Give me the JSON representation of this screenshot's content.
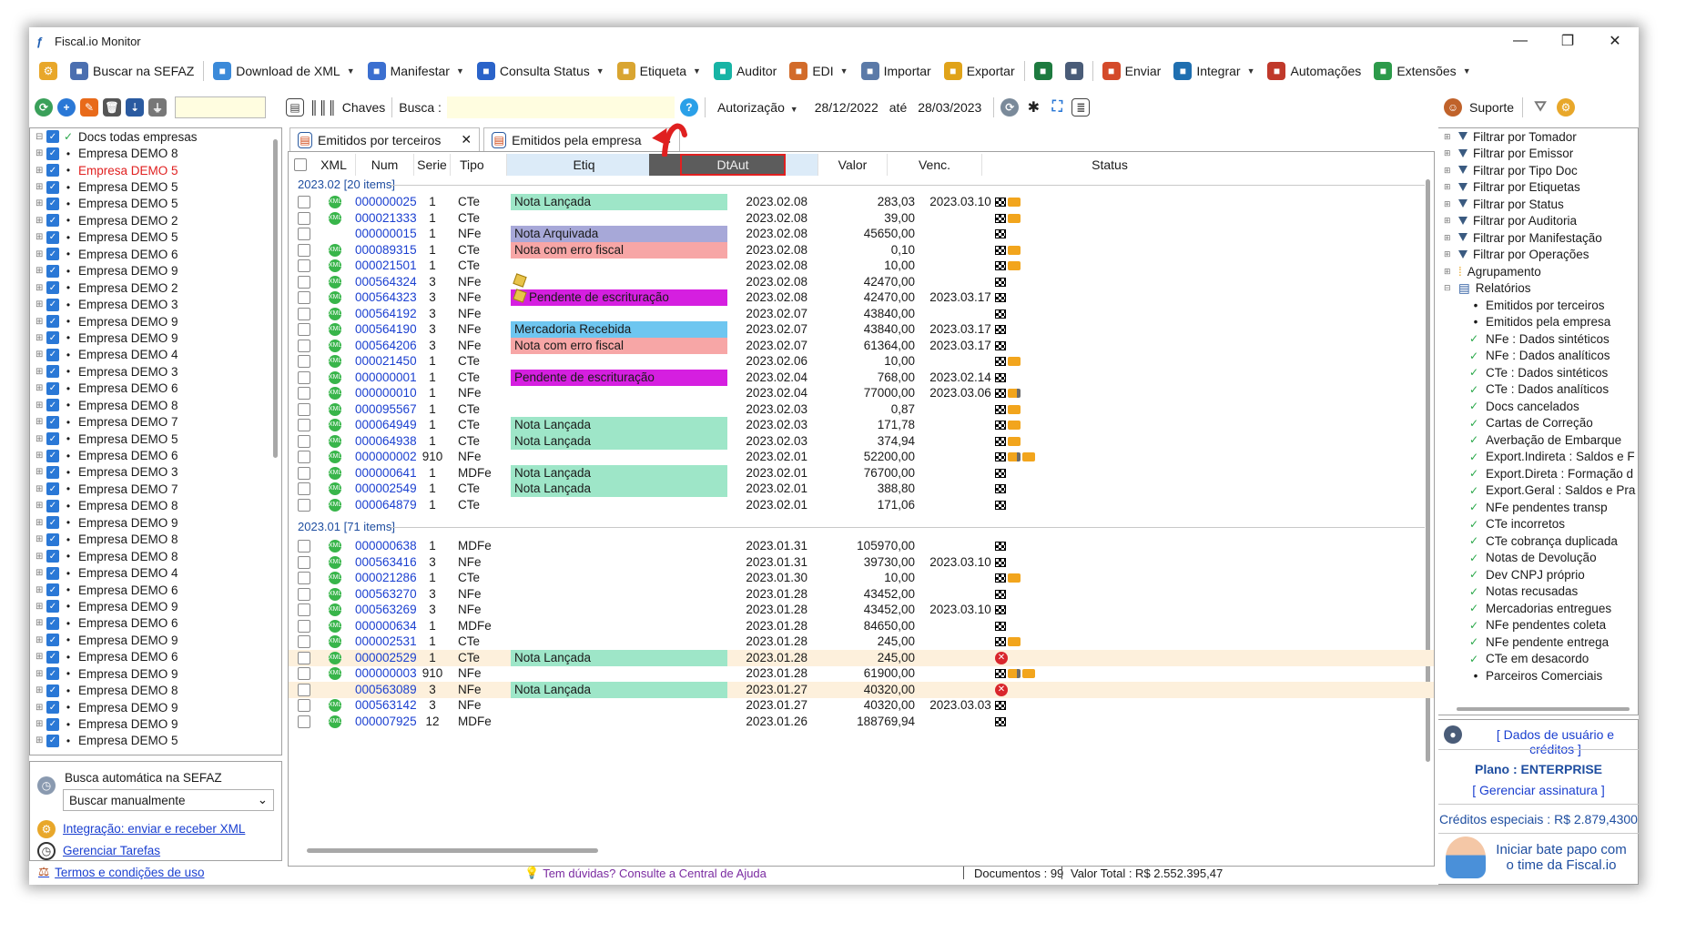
{
  "window": {
    "title": "Fiscal.io Monitor",
    "minimize": "—",
    "restore": "❐",
    "close": "✕"
  },
  "toolbar": {
    "items": [
      {
        "label": "Buscar na SEFAZ",
        "icon": "cloud-search-icon",
        "caret": false,
        "color": "#4b6fb0"
      },
      {
        "label": "Download de XML",
        "icon": "xml-download-icon",
        "caret": true,
        "color": "#3b8ad9"
      },
      {
        "label": "Manifestar",
        "icon": "manifest-icon",
        "caret": true,
        "color": "#3b6fd0"
      },
      {
        "label": "Consulta Status",
        "icon": "status-check-icon",
        "caret": true,
        "color": "#2a63c9"
      },
      {
        "label": "Etiqueta",
        "icon": "tag-icon",
        "caret": true,
        "color": "#d9a531"
      },
      {
        "label": "Auditor",
        "icon": "auditor-icon",
        "caret": false,
        "color": "#17b4a5"
      },
      {
        "label": "EDI",
        "icon": "truck-icon",
        "caret": true,
        "color": "#d26b2a"
      },
      {
        "label": "Importar",
        "icon": "import-icon",
        "caret": false,
        "color": "#5b7aa8"
      },
      {
        "label": "Exportar",
        "icon": "export-icon",
        "caret": false,
        "color": "#e0a31a"
      },
      {
        "label": "",
        "icon": "excel-icon",
        "caret": false,
        "color": "#1d7a3f"
      },
      {
        "label": "",
        "icon": "print-icon",
        "caret": false,
        "color": "#4a5c78"
      },
      {
        "label": "Enviar",
        "icon": "mail-icon",
        "caret": false,
        "color": "#d44a2a"
      },
      {
        "label": "Integrar",
        "icon": "integrate-icon",
        "caret": true,
        "color": "#1f6fb0"
      },
      {
        "label": "Automações",
        "icon": "automation-icon",
        "caret": false,
        "color": "#c0392b"
      },
      {
        "label": "Extensões",
        "icon": "extensions-icon",
        "caret": true,
        "color": "#2c9a4a"
      }
    ]
  },
  "left": {
    "tree_root": "Docs todas empresas",
    "companies": [
      {
        "label": "Empresa DEMO 8",
        "red": false
      },
      {
        "label": "Empresa DEMO 5",
        "red": true
      },
      {
        "label": "Empresa DEMO 5",
        "red": false
      },
      {
        "label": "Empresa DEMO 5",
        "red": false
      },
      {
        "label": "Empresa DEMO 2",
        "red": false
      },
      {
        "label": "Empresa DEMO 5",
        "red": false
      },
      {
        "label": "Empresa DEMO 6",
        "red": false
      },
      {
        "label": "Empresa DEMO 9",
        "red": false
      },
      {
        "label": "Empresa DEMO 2",
        "red": false
      },
      {
        "label": "Empresa DEMO 3",
        "red": false
      },
      {
        "label": "Empresa DEMO 9",
        "red": false
      },
      {
        "label": "Empresa DEMO 9",
        "red": false
      },
      {
        "label": "Empresa DEMO 4",
        "red": false
      },
      {
        "label": "Empresa DEMO 3",
        "red": false
      },
      {
        "label": "Empresa DEMO 6",
        "red": false
      },
      {
        "label": "Empresa DEMO 8",
        "red": false
      },
      {
        "label": "Empresa DEMO 7",
        "red": false
      },
      {
        "label": "Empresa DEMO 5",
        "red": false
      },
      {
        "label": "Empresa DEMO 6",
        "red": false
      },
      {
        "label": "Empresa DEMO 3",
        "red": false
      },
      {
        "label": "Empresa DEMO 7",
        "red": false
      },
      {
        "label": "Empresa DEMO 8",
        "red": false
      },
      {
        "label": "Empresa DEMO 9",
        "red": false
      },
      {
        "label": "Empresa DEMO 8",
        "red": false
      },
      {
        "label": "Empresa DEMO 8",
        "red": false
      },
      {
        "label": "Empresa DEMO 4",
        "red": false
      },
      {
        "label": "Empresa DEMO 6",
        "red": false
      },
      {
        "label": "Empresa DEMO 9",
        "red": false
      },
      {
        "label": "Empresa DEMO 6",
        "red": false
      },
      {
        "label": "Empresa DEMO 9",
        "red": false
      },
      {
        "label": "Empresa DEMO 6",
        "red": false
      },
      {
        "label": "Empresa DEMO 9",
        "red": false
      },
      {
        "label": "Empresa DEMO 8",
        "red": false
      },
      {
        "label": "Empresa DEMO 9",
        "red": false
      },
      {
        "label": "Empresa DEMO 9",
        "red": false
      },
      {
        "label": "Empresa DEMO 5",
        "red": false
      }
    ],
    "auto_title": "Busca automática na SEFAZ",
    "auto_select": "Buscar manualmente",
    "integration_link": "Integração: enviar e receber XML",
    "tasks_link": "Gerenciar Tarefas",
    "terms_link": "Termos e condições de uso"
  },
  "main": {
    "chaves_label": "Chaves",
    "busca_label": "Busca :",
    "date_field_label": "Autorização",
    "date_from": "28/12/2022",
    "ate_label": "até",
    "date_to": "28/03/2023",
    "tabs": [
      {
        "label": "Emitidos por terceiros",
        "close": "✕"
      },
      {
        "label": "Emitidos pela empresa",
        "close": "✕"
      }
    ],
    "headers": {
      "xml": "XML",
      "num": "Num",
      "serie": "Serie",
      "tipo": "Tipo",
      "etiq": "Etiq",
      "dtaut": "DtAut",
      "valor": "Valor",
      "venc": "Venc.",
      "status": "Status"
    },
    "group1": "2023.02 [20 items]",
    "group2": "2023.01 [71 items]",
    "rows_group1": [
      {
        "num": "000000025",
        "serie": "1",
        "tipo": "CTe",
        "etiq": "Nota Lançada",
        "etiq_color": "#9ee6c8",
        "etiq_icon": false,
        "xml": true,
        "dt": "2023.02.08",
        "valor": "283,03",
        "venc": "2023.03.10",
        "status": [
          "flag",
          "truck"
        ]
      },
      {
        "num": "000021333",
        "serie": "1",
        "tipo": "CTe",
        "etiq": "",
        "etiq_color": "",
        "etiq_icon": false,
        "xml": true,
        "dt": "2023.02.08",
        "valor": "39,00",
        "venc": "",
        "status": [
          "flag",
          "truck"
        ]
      },
      {
        "num": "000000015",
        "serie": "1",
        "tipo": "NFe",
        "etiq": "Nota Arquivada",
        "etiq_color": "#a7a8d8",
        "etiq_icon": false,
        "xml": false,
        "dt": "2023.02.08",
        "valor": "45650,00",
        "venc": "",
        "status": [
          "flag"
        ]
      },
      {
        "num": "000089315",
        "serie": "1",
        "tipo": "CTe",
        "etiq": "Nota com erro fiscal",
        "etiq_color": "#f7a6a6",
        "etiq_icon": false,
        "xml": true,
        "dt": "2023.02.08",
        "valor": "0,10",
        "venc": "",
        "status": [
          "flag",
          "truck"
        ]
      },
      {
        "num": "000021501",
        "serie": "1",
        "tipo": "CTe",
        "etiq": "",
        "etiq_color": "",
        "etiq_icon": false,
        "xml": true,
        "dt": "2023.02.08",
        "valor": "10,00",
        "venc": "",
        "status": [
          "flag",
          "truck"
        ]
      },
      {
        "num": "000564324",
        "serie": "3",
        "tipo": "NFe",
        "etiq": "",
        "etiq_color": "",
        "etiq_icon": true,
        "xml": true,
        "dt": "2023.02.08",
        "valor": "42470,00",
        "venc": "",
        "status": [
          "flag"
        ]
      },
      {
        "num": "000564323",
        "serie": "3",
        "tipo": "NFe",
        "etiq": "Pendente de escrituração",
        "etiq_color": "#d51fe0",
        "etiq_icon": true,
        "xml": true,
        "dt": "2023.02.08",
        "valor": "42470,00",
        "venc": "2023.03.17",
        "status": [
          "flag"
        ]
      },
      {
        "num": "000564192",
        "serie": "3",
        "tipo": "NFe",
        "etiq": "",
        "etiq_color": "",
        "etiq_icon": false,
        "xml": true,
        "dt": "2023.02.07",
        "valor": "43840,00",
        "venc": "",
        "status": [
          "flag"
        ]
      },
      {
        "num": "000564190",
        "serie": "3",
        "tipo": "NFe",
        "etiq": "Mercadoria Recebida",
        "etiq_color": "#6ec6f0",
        "etiq_icon": false,
        "xml": true,
        "dt": "2023.02.07",
        "valor": "43840,00",
        "venc": "2023.03.17",
        "status": [
          "flag"
        ]
      },
      {
        "num": "000564206",
        "serie": "3",
        "tipo": "NFe",
        "etiq": "Nota com erro fiscal",
        "etiq_color": "#f7a6a6",
        "etiq_icon": false,
        "xml": true,
        "dt": "2023.02.07",
        "valor": "61364,00",
        "venc": "2023.03.17",
        "status": [
          "flag"
        ]
      },
      {
        "num": "000021450",
        "serie": "1",
        "tipo": "CTe",
        "etiq": "",
        "etiq_color": "",
        "etiq_icon": false,
        "xml": true,
        "dt": "2023.02.06",
        "valor": "10,00",
        "venc": "",
        "status": [
          "flag",
          "truck"
        ]
      },
      {
        "num": "000000001",
        "serie": "1",
        "tipo": "CTe",
        "etiq": "Pendente de escrituração",
        "etiq_color": "#d51fe0",
        "etiq_icon": false,
        "xml": true,
        "dt": "2023.02.04",
        "valor": "768,00",
        "venc": "2023.02.14",
        "status": [
          "flag"
        ]
      },
      {
        "num": "000000010",
        "serie": "1",
        "tipo": "NFe",
        "etiq": "",
        "etiq_color": "",
        "etiq_icon": false,
        "xml": true,
        "dt": "2023.02.04",
        "valor": "77000,00",
        "venc": "2023.03.06",
        "status": [
          "flag",
          "truck2"
        ]
      },
      {
        "num": "000095567",
        "serie": "1",
        "tipo": "CTe",
        "etiq": "",
        "etiq_color": "",
        "etiq_icon": false,
        "xml": true,
        "dt": "2023.02.03",
        "valor": "0,87",
        "venc": "",
        "status": [
          "flag",
          "truck"
        ]
      },
      {
        "num": "000064949",
        "serie": "1",
        "tipo": "CTe",
        "etiq": "Nota Lançada",
        "etiq_color": "#9ee6c8",
        "etiq_icon": false,
        "xml": true,
        "dt": "2023.02.03",
        "valor": "171,78",
        "venc": "",
        "status": [
          "flag",
          "truck"
        ]
      },
      {
        "num": "000064938",
        "serie": "1",
        "tipo": "CTe",
        "etiq": "Nota Lançada",
        "etiq_color": "#9ee6c8",
        "etiq_icon": false,
        "xml": true,
        "dt": "2023.02.03",
        "valor": "374,94",
        "venc": "",
        "status": [
          "flag",
          "truck"
        ]
      },
      {
        "num": "000000002",
        "serie": "910",
        "tipo": "NFe",
        "etiq": "",
        "etiq_color": "",
        "etiq_icon": false,
        "xml": true,
        "dt": "2023.02.01",
        "valor": "52200,00",
        "venc": "",
        "status": [
          "flag",
          "truck2",
          "truck"
        ]
      },
      {
        "num": "000000641",
        "serie": "1",
        "tipo": "MDFe",
        "etiq": "Nota Lançada",
        "etiq_color": "#9ee6c8",
        "etiq_icon": false,
        "xml": true,
        "dt": "2023.02.01",
        "valor": "76700,00",
        "venc": "",
        "status": [
          "flag"
        ]
      },
      {
        "num": "000002549",
        "serie": "1",
        "tipo": "CTe",
        "etiq": "Nota Lançada",
        "etiq_color": "#9ee6c8",
        "etiq_icon": false,
        "xml": true,
        "dt": "2023.02.01",
        "valor": "388,80",
        "venc": "",
        "status": [
          "flag"
        ]
      },
      {
        "num": "000064879",
        "serie": "1",
        "tipo": "CTe",
        "etiq": "",
        "etiq_color": "",
        "etiq_icon": false,
        "xml": true,
        "dt": "2023.02.01",
        "valor": "171,06",
        "venc": "",
        "status": [
          "flag"
        ]
      }
    ],
    "rows_group2": [
      {
        "num": "000000638",
        "serie": "1",
        "tipo": "MDFe",
        "etiq": "",
        "etiq_color": "",
        "etiq_icon": false,
        "xml": true,
        "dt": "2023.01.31",
        "valor": "105970,00",
        "venc": "",
        "status": [
          "flag"
        ],
        "hl": false
      },
      {
        "num": "000563416",
        "serie": "3",
        "tipo": "NFe",
        "etiq": "",
        "etiq_color": "",
        "etiq_icon": false,
        "xml": true,
        "dt": "2023.01.31",
        "valor": "39730,00",
        "venc": "2023.03.10",
        "status": [
          "flag"
        ],
        "hl": false
      },
      {
        "num": "000021286",
        "serie": "1",
        "tipo": "CTe",
        "etiq": "",
        "etiq_color": "",
        "etiq_icon": false,
        "xml": true,
        "dt": "2023.01.30",
        "valor": "10,00",
        "venc": "",
        "status": [
          "flag",
          "truck"
        ],
        "hl": false
      },
      {
        "num": "000563270",
        "serie": "3",
        "tipo": "NFe",
        "etiq": "",
        "etiq_color": "",
        "etiq_icon": false,
        "xml": true,
        "dt": "2023.01.28",
        "valor": "43452,00",
        "venc": "",
        "status": [
          "flag"
        ],
        "hl": false
      },
      {
        "num": "000563269",
        "serie": "3",
        "tipo": "NFe",
        "etiq": "",
        "etiq_color": "",
        "etiq_icon": false,
        "xml": true,
        "dt": "2023.01.28",
        "valor": "43452,00",
        "venc": "2023.03.10",
        "status": [
          "flag"
        ],
        "hl": false
      },
      {
        "num": "000000634",
        "serie": "1",
        "tipo": "MDFe",
        "etiq": "",
        "etiq_color": "",
        "etiq_icon": false,
        "xml": true,
        "dt": "2023.01.28",
        "valor": "84650,00",
        "venc": "",
        "status": [
          "flag"
        ],
        "hl": false
      },
      {
        "num": "000002531",
        "serie": "1",
        "tipo": "CTe",
        "etiq": "",
        "etiq_color": "",
        "etiq_icon": false,
        "xml": true,
        "dt": "2023.01.28",
        "valor": "245,00",
        "venc": "",
        "status": [
          "flag",
          "truck"
        ],
        "hl": false
      },
      {
        "num": "000002529",
        "serie": "1",
        "tipo": "CTe",
        "etiq": "Nota Lançada",
        "etiq_color": "#9ee6c8",
        "etiq_icon": false,
        "xml": true,
        "dt": "2023.01.28",
        "valor": "245,00",
        "venc": "",
        "status": [
          "err"
        ],
        "hl": true
      },
      {
        "num": "000000003",
        "serie": "910",
        "tipo": "NFe",
        "etiq": "",
        "etiq_color": "",
        "etiq_icon": false,
        "xml": true,
        "dt": "2023.01.28",
        "valor": "61900,00",
        "venc": "",
        "status": [
          "flag",
          "truck2",
          "truck"
        ],
        "hl": false
      },
      {
        "num": "000563089",
        "serie": "3",
        "tipo": "NFe",
        "etiq": "Nota Lançada",
        "etiq_color": "#9ee6c8",
        "etiq_icon": false,
        "xml": false,
        "dt": "2023.01.27",
        "valor": "40320,00",
        "venc": "",
        "status": [
          "err"
        ],
        "hl": true
      },
      {
        "num": "000563142",
        "serie": "3",
        "tipo": "NFe",
        "etiq": "",
        "etiq_color": "",
        "etiq_icon": false,
        "xml": true,
        "dt": "2023.01.27",
        "valor": "40320,00",
        "venc": "2023.03.03",
        "status": [
          "flag"
        ],
        "hl": false
      },
      {
        "num": "000007925",
        "serie": "12",
        "tipo": "MDFe",
        "etiq": "",
        "etiq_color": "",
        "etiq_icon": false,
        "xml": true,
        "dt": "2023.01.26",
        "valor": "188769,94",
        "venc": "",
        "status": [
          "flag"
        ],
        "hl": false
      }
    ],
    "help_text": "Tem dúvidas? Consulte a Central de Ajuda",
    "docs_count": "Documentos : 99",
    "total_value": "Valor Total : R$ 2.552.395,47"
  },
  "right": {
    "support_label": "Suporte",
    "filters": [
      "Filtrar por Tomador",
      "Filtrar por Emissor",
      "Filtrar por Tipo Doc",
      "Filtrar por Etiquetas",
      "Filtrar por Status",
      "Filtrar por Auditoria",
      "Filtrar por Manifestação",
      "Filtrar por Operações"
    ],
    "agrupamento": "Agrupamento",
    "relatorios": "Relatórios",
    "report_items_bullet": [
      "Emitidos por terceiros",
      "Emitidos pela empresa"
    ],
    "report_items_check": [
      "NFe : Dados sintéticos",
      "NFe : Dados analíticos",
      "CTe : Dados sintéticos",
      "CTe : Dados analíticos",
      "Docs cancelados",
      "Cartas de Correção",
      "Averbação de Embarque",
      "Export.Indireta : Saldos e F",
      "Export.Direta : Formação d",
      "Export.Geral : Saldos e Pra",
      "NFe pendentes transp",
      "CTe incorretos",
      "CTe cobrança duplicada",
      "Notas de Devolução",
      "Dev CNPJ próprio",
      "Notas recusadas",
      "Mercadorias entregues",
      "NFe pendentes coleta",
      "NFe pendente entrega",
      "CTe em desacordo"
    ],
    "report_last": "Parceiros Comerciais",
    "user_link": "[ Dados de usuário e créditos ]",
    "plan": "Plano : ENTERPRISE",
    "manage": "[ Gerenciar assinatura ]",
    "credits": "Créditos especiais : R$ 2.879,4300",
    "chat_line1": "Iniciar bate papo com",
    "chat_line2": "o time da Fiscal.io"
  }
}
